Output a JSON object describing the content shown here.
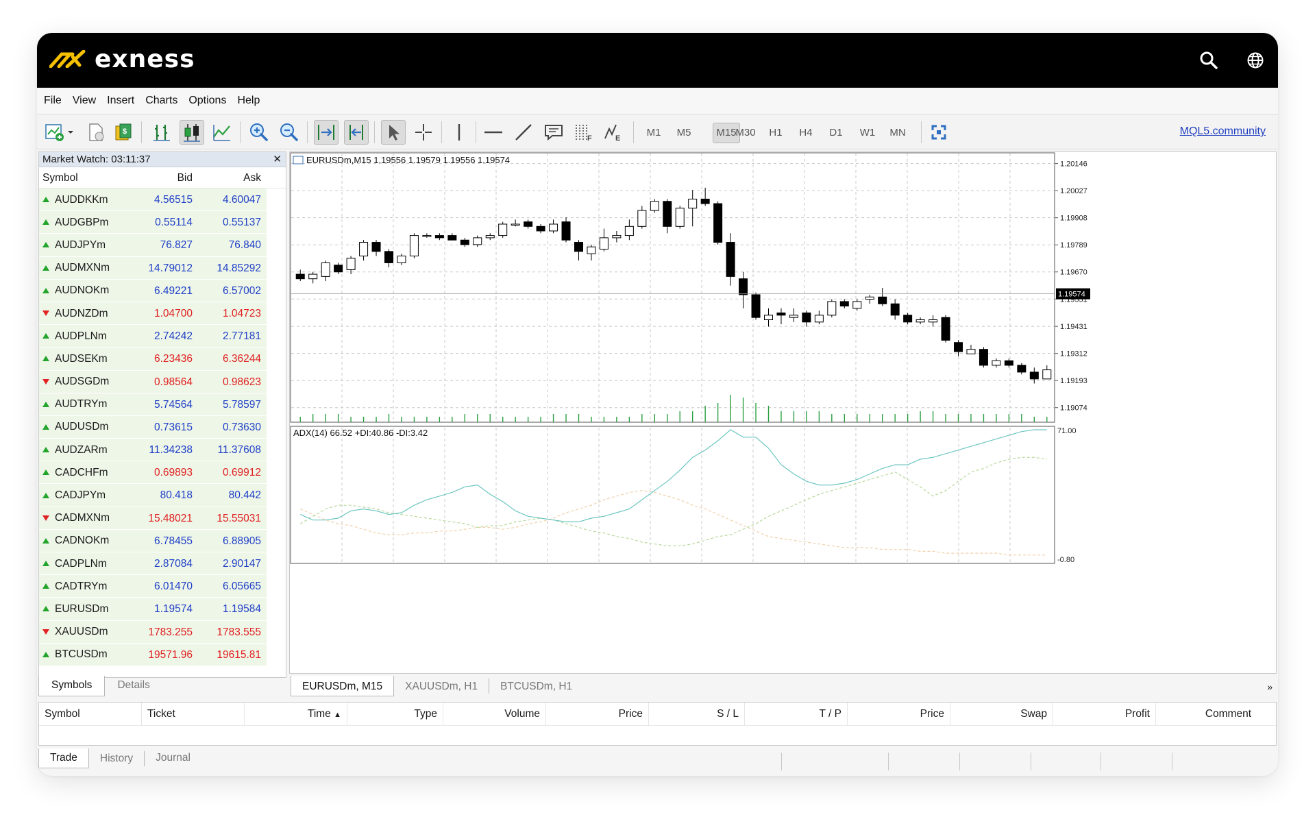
{
  "brand": {
    "name": "exness",
    "accent": "#f5c000"
  },
  "menu": [
    "File",
    "View",
    "Insert",
    "Charts",
    "Options",
    "Help"
  ],
  "toolbar": {
    "timeframes": [
      "M1",
      "M5",
      "M15",
      "M30",
      "H1",
      "H4",
      "D1",
      "W1",
      "MN"
    ],
    "active_timeframe": "M15",
    "community_link": "MQL5.community"
  },
  "market_watch": {
    "title": "Market Watch: 03:11:37",
    "columns": [
      "Symbol",
      "Bid",
      "Ask"
    ],
    "rows": [
      {
        "symbol": "AUDDKKm",
        "bid": "4.56515",
        "ask": "4.60047",
        "dir": "up",
        "color": "blue"
      },
      {
        "symbol": "AUDGBPm",
        "bid": "0.55114",
        "ask": "0.55137",
        "dir": "up",
        "color": "blue"
      },
      {
        "symbol": "AUDJPYm",
        "bid": "76.827",
        "ask": "76.840",
        "dir": "up",
        "color": "blue"
      },
      {
        "symbol": "AUDMXNm",
        "bid": "14.79012",
        "ask": "14.85292",
        "dir": "up",
        "color": "blue"
      },
      {
        "symbol": "AUDNOKm",
        "bid": "6.49221",
        "ask": "6.57002",
        "dir": "up",
        "color": "blue"
      },
      {
        "symbol": "AUDNZDm",
        "bid": "1.04700",
        "ask": "1.04723",
        "dir": "down",
        "color": "red"
      },
      {
        "symbol": "AUDPLNm",
        "bid": "2.74242",
        "ask": "2.77181",
        "dir": "up",
        "color": "blue"
      },
      {
        "symbol": "AUDSEKm",
        "bid": "6.23436",
        "ask": "6.36244",
        "dir": "up",
        "color": "red"
      },
      {
        "symbol": "AUDSGDm",
        "bid": "0.98564",
        "ask": "0.98623",
        "dir": "down",
        "color": "red"
      },
      {
        "symbol": "AUDTRYm",
        "bid": "5.74564",
        "ask": "5.78597",
        "dir": "up",
        "color": "blue"
      },
      {
        "symbol": "AUDUSDm",
        "bid": "0.73615",
        "ask": "0.73630",
        "dir": "up",
        "color": "blue"
      },
      {
        "symbol": "AUDZARm",
        "bid": "11.34238",
        "ask": "11.37608",
        "dir": "up",
        "color": "blue"
      },
      {
        "symbol": "CADCHFm",
        "bid": "0.69893",
        "ask": "0.69912",
        "dir": "up",
        "color": "red"
      },
      {
        "symbol": "CADJPYm",
        "bid": "80.418",
        "ask": "80.442",
        "dir": "up",
        "color": "blue"
      },
      {
        "symbol": "CADMXNm",
        "bid": "15.48021",
        "ask": "15.55031",
        "dir": "down",
        "color": "red"
      },
      {
        "symbol": "CADNOKm",
        "bid": "6.78455",
        "ask": "6.88905",
        "dir": "up",
        "color": "blue"
      },
      {
        "symbol": "CADPLNm",
        "bid": "2.87084",
        "ask": "2.90147",
        "dir": "up",
        "color": "blue"
      },
      {
        "symbol": "CADTRYm",
        "bid": "6.01470",
        "ask": "6.05665",
        "dir": "up",
        "color": "blue"
      },
      {
        "symbol": "EURUSDm",
        "bid": "1.19574",
        "ask": "1.19584",
        "dir": "up",
        "color": "blue"
      },
      {
        "symbol": "XAUUSDm",
        "bid": "1783.255",
        "ask": "1783.555",
        "dir": "down",
        "color": "red"
      },
      {
        "symbol": "BTCUSDm",
        "bid": "19571.96",
        "ask": "19615.81",
        "dir": "up",
        "color": "red"
      }
    ],
    "tabs": [
      "Symbols",
      "Details"
    ]
  },
  "chart": {
    "header": "EURUSDm,M15  1.19556 1.19579 1.19556 1.19574",
    "price_labels": [
      "1.20146",
      "1.20027",
      "1.19908",
      "1.19789",
      "1.19670",
      "1.19551",
      "1.19431",
      "1.19312",
      "1.19193",
      "1.19074"
    ],
    "current_price": "1.19574",
    "indicator_header": "ADX(14) 66.52 +DI:40.86 -DI:3.42",
    "indicator_labels": [
      "71.00",
      "-0.80"
    ],
    "tabs": [
      "EURUSDm, M15",
      "XAUUSDm, H1",
      "BTCUSDm, H1"
    ]
  },
  "chart_data": {
    "type": "candlestick",
    "ylim": [
      1.1901,
      1.2019
    ],
    "candles": [
      [
        1.1966,
        1.1968,
        1.1963,
        1.1964
      ],
      [
        1.1964,
        1.1967,
        1.1962,
        1.1966
      ],
      [
        1.1965,
        1.1972,
        1.1963,
        1.1971
      ],
      [
        1.197,
        1.1971,
        1.1966,
        1.1967
      ],
      [
        1.1968,
        1.1974,
        1.1966,
        1.1973
      ],
      [
        1.1974,
        1.1981,
        1.1972,
        1.198
      ],
      [
        1.198,
        1.1981,
        1.1974,
        1.1976
      ],
      [
        1.1976,
        1.1977,
        1.1969,
        1.1971
      ],
      [
        1.1971,
        1.1975,
        1.197,
        1.1974
      ],
      [
        1.1974,
        1.1984,
        1.1973,
        1.1983
      ],
      [
        1.1983,
        1.1984,
        1.1982,
        1.1983
      ],
      [
        1.1983,
        1.1984,
        1.1981,
        1.1982
      ],
      [
        1.1983,
        1.1984,
        1.1981,
        1.1981
      ],
      [
        1.1981,
        1.1982,
        1.1978,
        1.1979
      ],
      [
        1.1979,
        1.1983,
        1.1978,
        1.1982
      ],
      [
        1.1982,
        1.1984,
        1.1981,
        1.1983
      ],
      [
        1.1983,
        1.1989,
        1.1982,
        1.1988
      ],
      [
        1.1988,
        1.199,
        1.1987,
        1.1988
      ],
      [
        1.1989,
        1.199,
        1.1986,
        1.1987
      ],
      [
        1.1987,
        1.1988,
        1.1984,
        1.1985
      ],
      [
        1.1985,
        1.199,
        1.1984,
        1.1988
      ],
      [
        1.1989,
        1.1991,
        1.198,
        1.1981
      ],
      [
        1.198,
        1.1981,
        1.1972,
        1.1976
      ],
      [
        1.1975,
        1.1979,
        1.1972,
        1.1978
      ],
      [
        1.1977,
        1.1986,
        1.1976,
        1.1982
      ],
      [
        1.1982,
        1.1985,
        1.198,
        1.1983
      ],
      [
        1.1983,
        1.199,
        1.1981,
        1.1987
      ],
      [
        1.1987,
        1.1996,
        1.1986,
        1.1994
      ],
      [
        1.1994,
        1.1999,
        1.1993,
        1.1998
      ],
      [
        1.1998,
        1.1999,
        1.1984,
        1.1987
      ],
      [
        1.1987,
        1.1996,
        1.1986,
        1.1995
      ],
      [
        1.1995,
        1.2003,
        1.1987,
        1.1999
      ],
      [
        1.1999,
        1.2004,
        1.1996,
        1.1997
      ],
      [
        1.1997,
        1.1998,
        1.1979,
        1.198
      ],
      [
        1.198,
        1.1984,
        1.1961,
        1.1965
      ],
      [
        1.1964,
        1.1967,
        1.1951,
        1.1957
      ],
      [
        1.1957,
        1.1958,
        1.1946,
        1.1947
      ],
      [
        1.1946,
        1.1951,
        1.1943,
        1.1948
      ],
      [
        1.1949,
        1.1951,
        1.1944,
        1.1948
      ],
      [
        1.1947,
        1.1951,
        1.1945,
        1.1948
      ],
      [
        1.1949,
        1.195,
        1.1943,
        1.1945
      ],
      [
        1.1945,
        1.195,
        1.1944,
        1.1948
      ],
      [
        1.1948,
        1.1955,
        1.1947,
        1.1954
      ],
      [
        1.1954,
        1.1955,
        1.1951,
        1.1952
      ],
      [
        1.1951,
        1.1955,
        1.195,
        1.1954
      ],
      [
        1.1955,
        1.1957,
        1.1953,
        1.1956
      ],
      [
        1.1956,
        1.196,
        1.1952,
        1.1953
      ],
      [
        1.1953,
        1.1955,
        1.1946,
        1.1948
      ],
      [
        1.1948,
        1.1949,
        1.1944,
        1.1945
      ],
      [
        1.1945,
        1.1947,
        1.1944,
        1.1946
      ],
      [
        1.1945,
        1.1948,
        1.1943,
        1.1946
      ],
      [
        1.1947,
        1.1948,
        1.1936,
        1.1937
      ],
      [
        1.1936,
        1.1937,
        1.193,
        1.1932
      ],
      [
        1.1931,
        1.1935,
        1.1931,
        1.1933
      ],
      [
        1.1933,
        1.1934,
        1.1925,
        1.1926
      ],
      [
        1.1926,
        1.1929,
        1.1925,
        1.1928
      ],
      [
        1.1928,
        1.1929,
        1.1925,
        1.1926
      ],
      [
        1.1926,
        1.1927,
        1.1922,
        1.1923
      ],
      [
        1.1923,
        1.1925,
        1.1918,
        1.192
      ],
      [
        1.192,
        1.1926,
        1.192,
        1.1924
      ]
    ],
    "volumes": [
      2,
      3,
      3,
      3,
      2,
      2,
      2,
      3,
      2,
      2,
      2,
      2,
      2,
      3,
      3,
      3,
      2,
      2,
      2,
      2,
      3,
      3,
      3,
      2,
      2,
      2,
      2,
      3,
      3,
      3,
      4,
      4,
      6,
      7,
      10,
      9,
      7,
      6,
      4,
      4,
      4,
      4,
      3,
      3,
      3,
      3,
      3,
      3,
      3,
      4,
      4,
      3,
      3,
      3,
      3,
      3,
      3,
      3,
      2,
      2
    ],
    "adx": {
      "ylim": [
        -0.8,
        71.0
      ],
      "adx_line": [
        25,
        22,
        22,
        23,
        27,
        28,
        27,
        25,
        26,
        30,
        33,
        35,
        37,
        40,
        41,
        36,
        32,
        27,
        24,
        23,
        22,
        21,
        21,
        23,
        24,
        26,
        28,
        33,
        38,
        43,
        49,
        56,
        60,
        65,
        71,
        67,
        67,
        61,
        52,
        47,
        43,
        41,
        41,
        42,
        44,
        47,
        50,
        52,
        52,
        55,
        56,
        58,
        60,
        62,
        64,
        66,
        68,
        70,
        71,
        71
      ],
      "plus_di": [
        20,
        24,
        28,
        30,
        30,
        29,
        28,
        26,
        25,
        24,
        23,
        22,
        21,
        20,
        18,
        19,
        19,
        21,
        22,
        23,
        22,
        20,
        18,
        16,
        15,
        13,
        12,
        10,
        9,
        8,
        8,
        9,
        11,
        13,
        14,
        17,
        20,
        24,
        27,
        30,
        33,
        36,
        38,
        40,
        42,
        44,
        46,
        48,
        44,
        40,
        35,
        38,
        43,
        48,
        50,
        53,
        55,
        56,
        56,
        55
      ],
      "minus_di": [
        28,
        25,
        22,
        20,
        19,
        17,
        15,
        14,
        14,
        15,
        15,
        16,
        16,
        17,
        18,
        18,
        17,
        18,
        20,
        21,
        23,
        26,
        28,
        30,
        33,
        35,
        37,
        38,
        37,
        35,
        33,
        30,
        28,
        25,
        22,
        19,
        16,
        13,
        12,
        11,
        10,
        9,
        8,
        7,
        7,
        7,
        6,
        6,
        6,
        5,
        5,
        4,
        4,
        4,
        4,
        4,
        3,
        3,
        3,
        3
      ]
    }
  },
  "terminal": {
    "columns": [
      "Symbol",
      "Ticket",
      "Time",
      "Type",
      "Volume",
      "Price",
      "S / L",
      "T / P",
      "Price",
      "Swap",
      "Profit",
      "Comment"
    ],
    "tabs": [
      "Trade",
      "History",
      "Journal"
    ]
  }
}
